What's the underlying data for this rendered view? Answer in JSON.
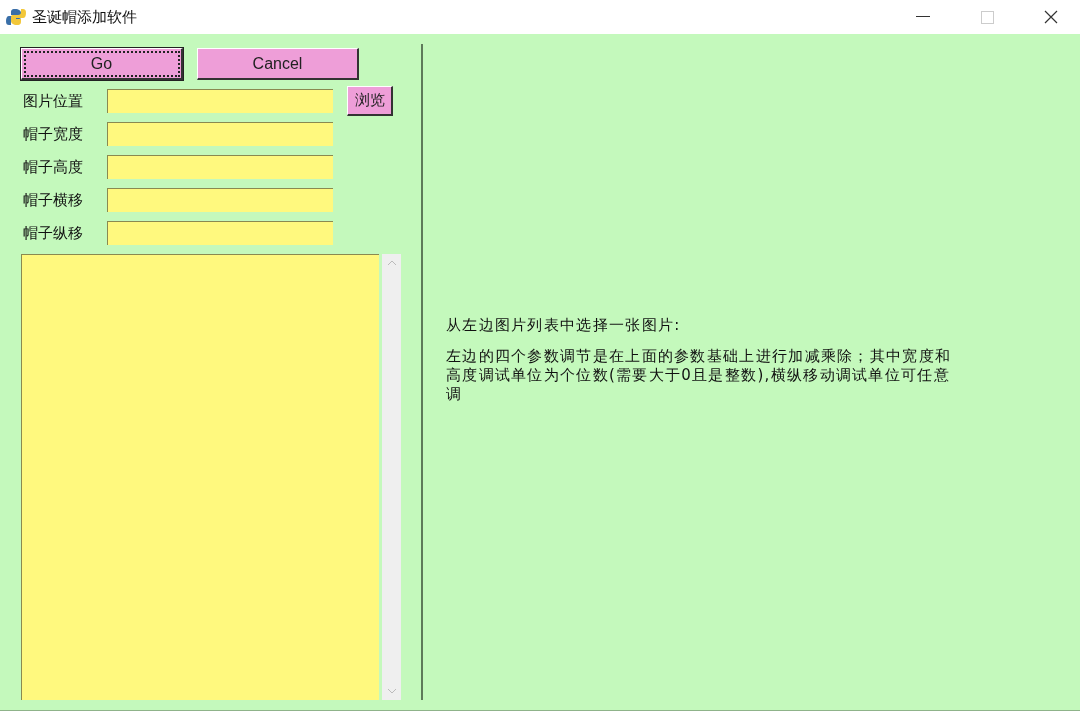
{
  "window": {
    "title": "圣诞帽添加软件"
  },
  "buttons": [
    {
      "label": "Go",
      "focused": true
    },
    {
      "label": "Cancel",
      "focused": false
    }
  ],
  "fields": [
    {
      "label": "图片位置",
      "browse": "浏览"
    },
    {
      "label": "帽子宽度"
    },
    {
      "label": "帽子高度"
    },
    {
      "label": "帽子横移"
    },
    {
      "label": "帽子纵移"
    }
  ],
  "instructions": [
    "从左边图片列表中选择一张图片:",
    "左边的四个参数调节是在上面的参数基础上进行加减乘除；其中宽度和高度调试单位为个位数(需要大于0且是整数),横纵移动调试单位可任意调"
  ]
}
